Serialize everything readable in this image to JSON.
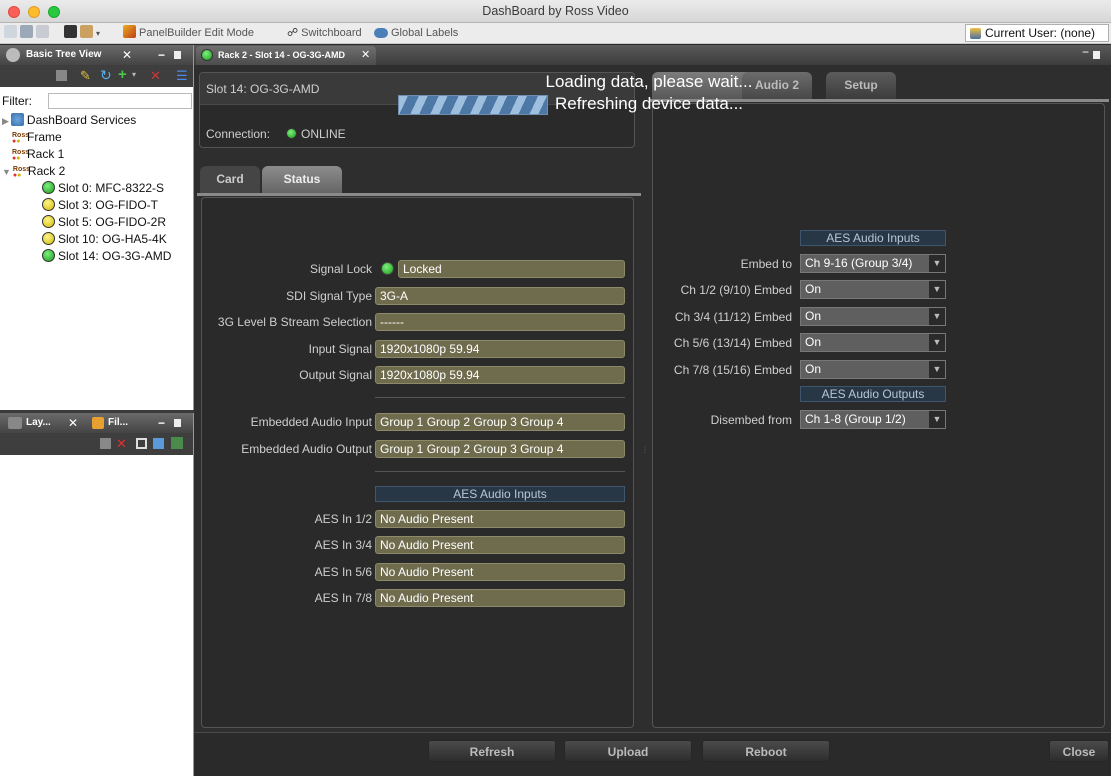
{
  "window": {
    "title": "DashBoard by Ross Video"
  },
  "toolbar": {
    "panelbuilder_label": "PanelBuilder Edit Mode",
    "switchboard_label": "Switchboard",
    "global_labels_label": "Global Labels",
    "current_user_label": "Current User: (none)"
  },
  "tree_view": {
    "tab_label": "Basic Tree View",
    "filter_label": "Filter:",
    "items": [
      "DashBoard Services",
      "Frame",
      "Rack 1",
      "Rack 2",
      "Slot 0: MFC-8322-S",
      "Slot 3: OG-FIDO-T",
      "Slot 5: OG-FIDO-2R",
      "Slot 10: OG-HA5-4K",
      "Slot 14: OG-3G-AMD"
    ]
  },
  "bottom_panel": {
    "tab1_label": "Lay...",
    "tab2_label": "Fil..."
  },
  "document_tab": {
    "label": "Rack 2 - Slot 14 - OG-3G-AMD"
  },
  "device": {
    "slot_title": "Slot 14: OG-3G-AMD",
    "connection_label": "Connection:",
    "connection_status": "ONLINE"
  },
  "loading": {
    "line1": "Loading data, please wait...",
    "line2": "Refreshing device data..."
  },
  "left_tabs": [
    "Card",
    "Status"
  ],
  "right_tabs": [
    "Audio 2",
    "Setup"
  ],
  "status": {
    "fields": [
      {
        "label": "Signal Lock",
        "value": "Locked"
      },
      {
        "label": "SDI Signal Type",
        "value": "3G-A"
      },
      {
        "label": "3G Level B Stream Selection",
        "value": "------"
      },
      {
        "label": "Input Signal",
        "value": "1920x1080p 59.94"
      },
      {
        "label": "Output Signal",
        "value": "1920x1080p 59.94"
      }
    ],
    "audio_fields": [
      {
        "label": "Embedded Audio Input",
        "value": "Group 1 Group 2 Group 3 Group 4"
      },
      {
        "label": "Embedded Audio Output",
        "value": "Group 1 Group 2 Group 3 Group 4"
      }
    ],
    "aes_header": "AES Audio Inputs",
    "aes_fields": [
      {
        "label": "AES In 1/2",
        "value": "No Audio Present"
      },
      {
        "label": "AES In 3/4",
        "value": "No Audio Present"
      },
      {
        "label": "AES In 5/6",
        "value": "No Audio Present"
      },
      {
        "label": "AES In 7/8",
        "value": "No Audio Present"
      }
    ]
  },
  "audio2": {
    "inputs_header": "AES Audio Inputs",
    "embed_rows": [
      {
        "label": "Embed to",
        "value": "Ch 9-16 (Group 3/4)"
      },
      {
        "label": "Ch 1/2 (9/10) Embed",
        "value": "On"
      },
      {
        "label": "Ch 3/4 (11/12) Embed",
        "value": "On"
      },
      {
        "label": "Ch 5/6 (13/14) Embed",
        "value": "On"
      },
      {
        "label": "Ch 7/8 (15/16) Embed",
        "value": "On"
      }
    ],
    "outputs_header": "AES Audio Outputs",
    "disembed": {
      "label": "Disembed from",
      "value": "Ch 1-8  (Group 1/2)"
    }
  },
  "buttons": {
    "refresh": "Refresh",
    "upload": "Upload",
    "reboot": "Reboot",
    "close": "Close"
  }
}
